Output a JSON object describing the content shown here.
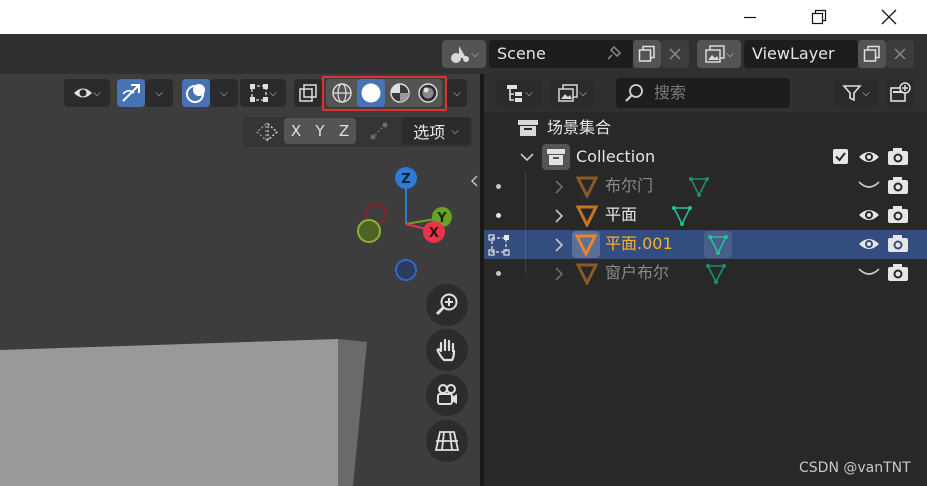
{
  "window": {
    "controls": [
      "minimize-icon",
      "restore-icon",
      "close-icon"
    ]
  },
  "scene_selector": {
    "value": "Scene"
  },
  "view_layer_selector": {
    "value": "ViewLayer"
  },
  "viewport_header": {
    "axis_labels": [
      "X",
      "Y",
      "Z"
    ],
    "options_label": "选项",
    "shading_modes": [
      "wireframe",
      "solid",
      "material-preview",
      "rendered"
    ],
    "active_shading": "solid"
  },
  "gizmo": {
    "z": "Z",
    "y": "Y",
    "x": "X"
  },
  "outliner": {
    "search_placeholder": "搜索",
    "root_label": "场景集合",
    "collection_label": "Collection",
    "items": [
      {
        "label": "布尔门",
        "state": "hidden"
      },
      {
        "label": "平面",
        "state": "visible"
      },
      {
        "label": "平面.001",
        "state": "active"
      },
      {
        "label": "窗户布尔",
        "state": "hidden"
      }
    ]
  },
  "colors": {
    "accent_blue": "#4772b3",
    "active_text": "#ffaf29",
    "mesh_icon": "#c5751e",
    "modifier_green": "#1fc495",
    "highlight_box": "#e03131"
  },
  "watermark": "CSDN @vanTNT"
}
